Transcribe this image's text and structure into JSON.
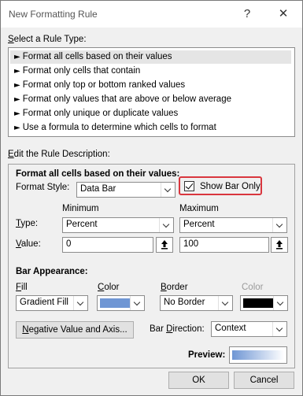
{
  "window": {
    "title": "New Formatting Rule",
    "help_glyph": "?",
    "close_glyph": "✕"
  },
  "rule_type": {
    "label": "Select a Rule Type:",
    "items": [
      "Format all cells based on their values",
      "Format only cells that contain",
      "Format only top or bottom ranked values",
      "Format only values that are above or below average",
      "Format only unique or duplicate values",
      "Use a formula to determine which cells to format"
    ],
    "selected_index": 0
  },
  "description": {
    "label": "Edit the Rule Description:",
    "heading": "Format all cells based on their values:",
    "format_style_label": "Format Style:",
    "format_style_value": "Data Bar",
    "show_bar_only_label": "Show Bar Only",
    "show_bar_only_checked": true,
    "highlight_color": "#d9363e",
    "minimum_label": "Minimum",
    "maximum_label": "Maximum",
    "type_label": "Type:",
    "value_label": "Value:",
    "min_type": "Percent",
    "max_type": "Percent",
    "min_value": "0",
    "max_value": "100",
    "bar_appearance_label": "Bar Appearance:",
    "fill_label": "Fill",
    "color_label": "Color",
    "border_label": "Border",
    "border_color_label": "Color",
    "fill_value": "Gradient Fill",
    "fill_color": "#6f96d4",
    "border_value": "No Border",
    "border_color": "#000000",
    "negative_button": "Negative Value and Axis...",
    "bar_direction_label": "Bar Direction:",
    "bar_direction_value": "Context",
    "preview_label": "Preview:"
  },
  "footer": {
    "ok_label": "OK",
    "cancel_label": "Cancel"
  }
}
